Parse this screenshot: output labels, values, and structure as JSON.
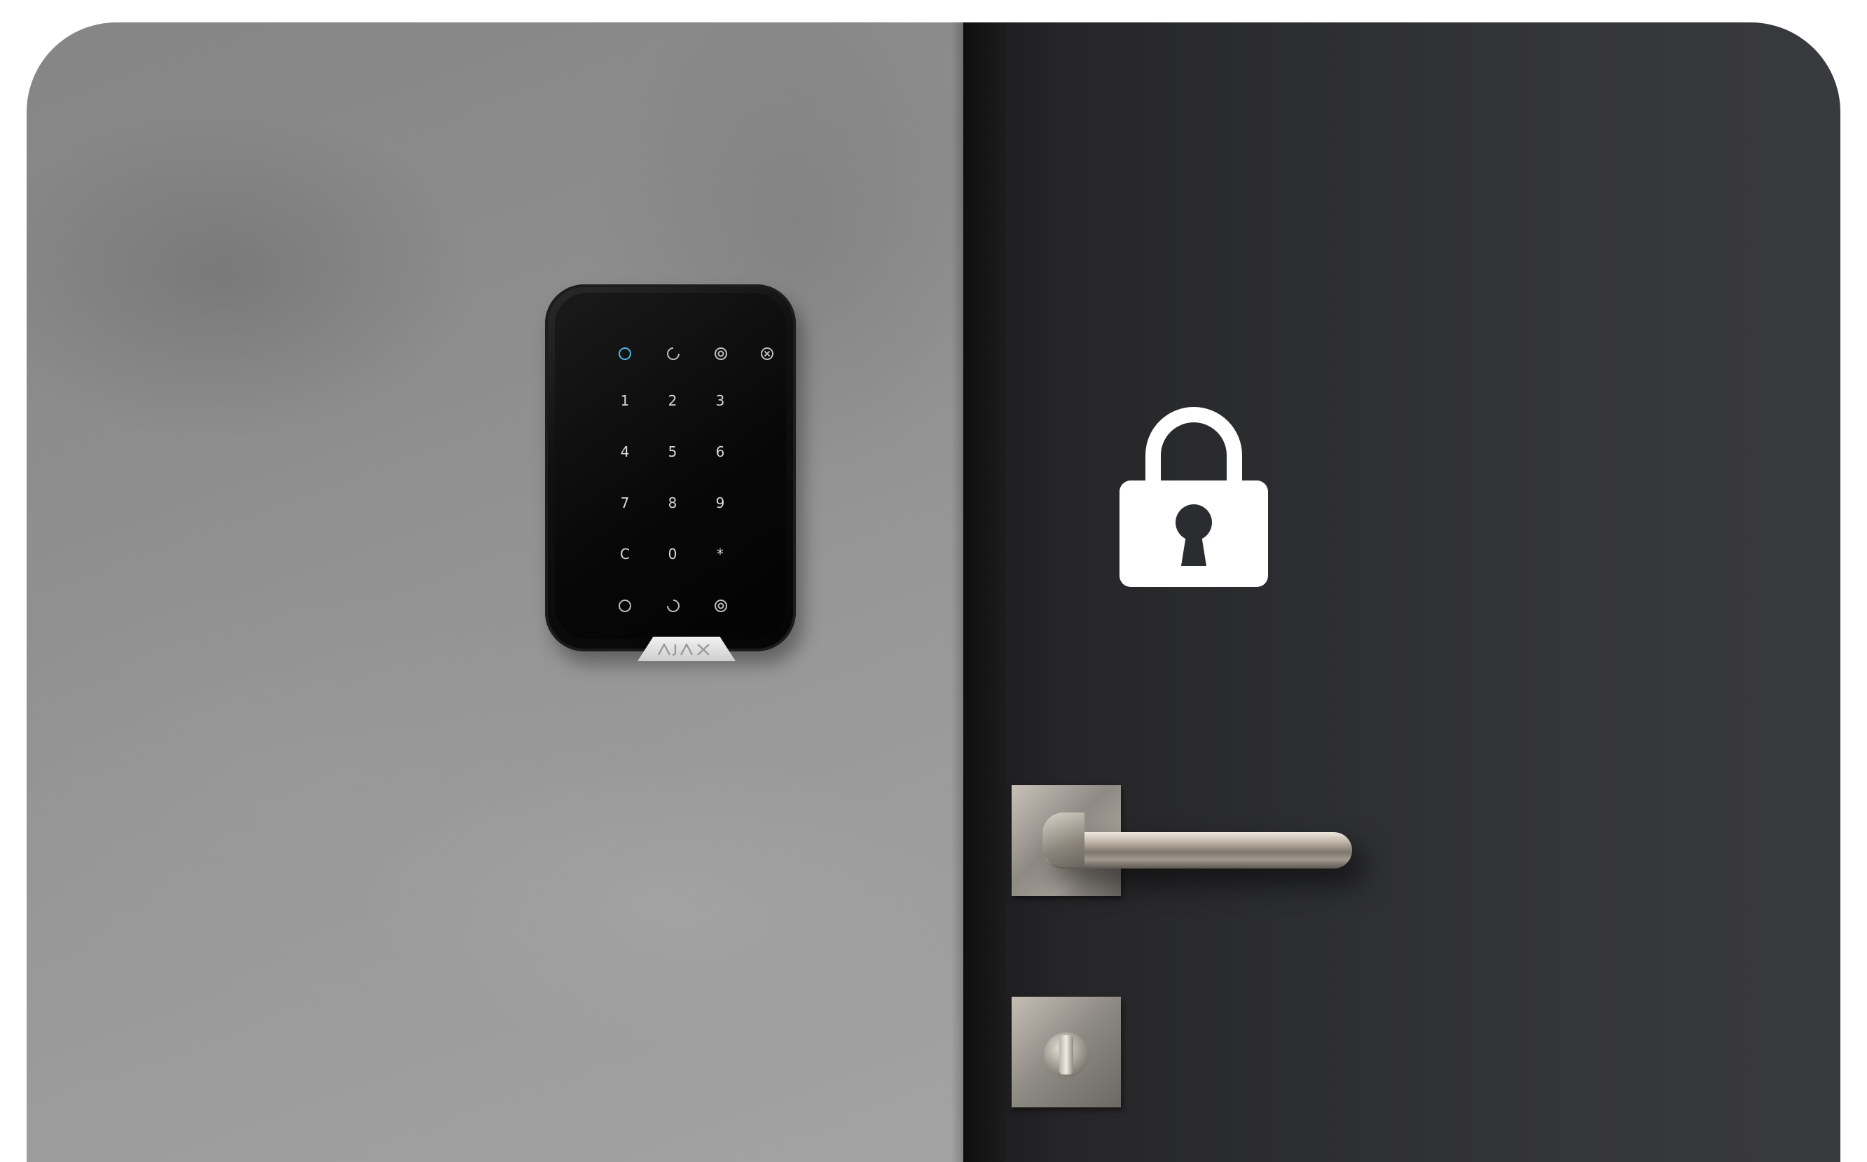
{
  "scene": {
    "keypad": {
      "brand_logo": "AJAX",
      "mode_icons": [
        "arm-icon",
        "night-mode-icon",
        "partial-arm-icon",
        "disarm-icon"
      ],
      "keys": [
        "1",
        "2",
        "3",
        "4",
        "5",
        "6",
        "7",
        "8",
        "9",
        "C",
        "0",
        "*"
      ],
      "function_icons": [
        "ring-icon",
        "night-icon",
        "target-icon"
      ],
      "indicator_color": "#4fb6e6"
    },
    "overlay": {
      "icon": "lock-icon",
      "color": "#ffffff"
    },
    "colors": {
      "wall": "#8e8e8e",
      "door": "#2e2f32",
      "keypad": "#0a0a0a",
      "handle": "#a39c92"
    }
  }
}
